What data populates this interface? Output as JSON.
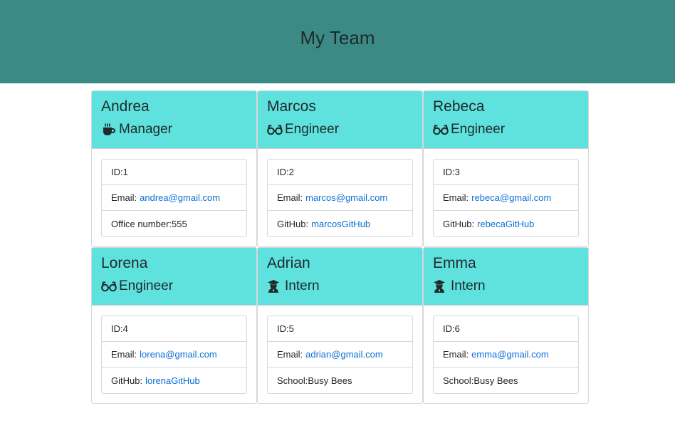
{
  "header": {
    "title": "My Team"
  },
  "labels": {
    "id_prefix": "ID: ",
    "email_prefix": "Email:",
    "office_prefix": "Office number: ",
    "github_prefix": "GitHub:",
    "school_prefix": "School: "
  },
  "team": [
    {
      "name": "Andrea",
      "role": "Manager",
      "icon": "coffee-icon",
      "id": "1",
      "email": "andrea@gmail.com",
      "extra_type": "office",
      "extra": "555"
    },
    {
      "name": "Marcos",
      "role": "Engineer",
      "icon": "glasses-icon",
      "id": "2",
      "email": "marcos@gmail.com",
      "extra_type": "github",
      "extra": "marcosGitHub"
    },
    {
      "name": "Rebeca",
      "role": "Engineer",
      "icon": "glasses-icon",
      "id": "3",
      "email": "rebeca@gmail.com",
      "extra_type": "github",
      "extra": "rebecaGitHub"
    },
    {
      "name": "Lorena",
      "role": "Engineer",
      "icon": "glasses-icon",
      "id": "4",
      "email": "lorena@gmail.com",
      "extra_type": "github",
      "extra": "lorenaGitHub"
    },
    {
      "name": "Adrian",
      "role": "Intern",
      "icon": "graduate-icon",
      "id": "5",
      "email": "adrian@gmail.com",
      "extra_type": "school",
      "extra": "Busy Bees"
    },
    {
      "name": "Emma",
      "role": "Intern",
      "icon": "graduate-icon",
      "id": "6",
      "email": "emma@gmail.com",
      "extra_type": "school",
      "extra": "Busy Bees"
    }
  ],
  "colors": {
    "header_bg": "#3c8a86",
    "card_head_bg": "#5fe1de",
    "link": "#0b6fd6"
  }
}
